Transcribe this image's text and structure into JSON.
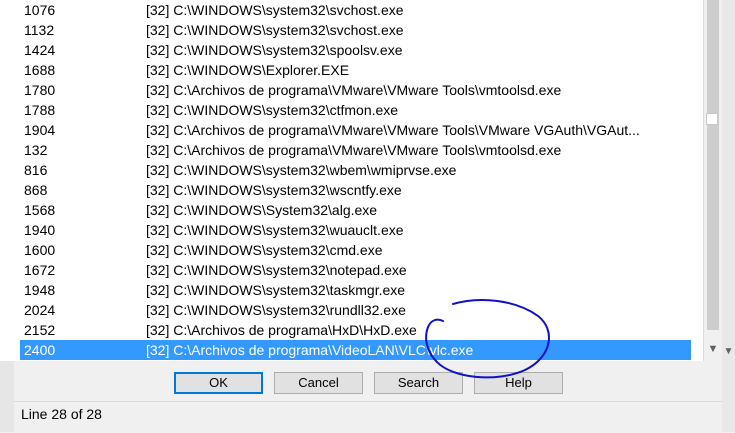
{
  "rows": [
    {
      "pid": "1076",
      "path": "[32] C:\\WINDOWS\\system32\\svchost.exe"
    },
    {
      "pid": "1132",
      "path": "[32] C:\\WINDOWS\\system32\\svchost.exe"
    },
    {
      "pid": "1424",
      "path": "[32] C:\\WINDOWS\\system32\\spoolsv.exe"
    },
    {
      "pid": "1688",
      "path": "[32] C:\\WINDOWS\\Explorer.EXE"
    },
    {
      "pid": "1780",
      "path": "[32] C:\\Archivos de programa\\VMware\\VMware Tools\\vmtoolsd.exe"
    },
    {
      "pid": "1788",
      "path": "[32] C:\\WINDOWS\\system32\\ctfmon.exe"
    },
    {
      "pid": "1904",
      "path": "[32] C:\\Archivos de programa\\VMware\\VMware Tools\\VMware VGAuth\\VGAut..."
    },
    {
      "pid": "132",
      "path": "[32] C:\\Archivos de programa\\VMware\\VMware Tools\\vmtoolsd.exe"
    },
    {
      "pid": "816",
      "path": "[32] C:\\WINDOWS\\system32\\wbem\\wmiprvse.exe"
    },
    {
      "pid": "868",
      "path": "[32] C:\\WINDOWS\\system32\\wscntfy.exe"
    },
    {
      "pid": "1568",
      "path": "[32] C:\\WINDOWS\\System32\\alg.exe"
    },
    {
      "pid": "1940",
      "path": "[32] C:\\WINDOWS\\system32\\wuauclt.exe"
    },
    {
      "pid": "1600",
      "path": "[32] C:\\WINDOWS\\system32\\cmd.exe"
    },
    {
      "pid": "1672",
      "path": "[32] C:\\WINDOWS\\system32\\notepad.exe"
    },
    {
      "pid": "1948",
      "path": "[32] C:\\WINDOWS\\system32\\taskmgr.exe"
    },
    {
      "pid": "2024",
      "path": "[32] C:\\WINDOWS\\system32\\rundll32.exe"
    },
    {
      "pid": "2152",
      "path": "[32] C:\\Archivos de programa\\HxD\\HxD.exe"
    },
    {
      "pid": "2400",
      "path": "[32] C:\\Archivos de programa\\VideoLAN\\VLC\\vlc.exe"
    }
  ],
  "selected_index": 17,
  "buttons": {
    "ok": "OK",
    "cancel": "Cancel",
    "search": "Search",
    "help": "Help"
  },
  "status": "Line 28 of 28",
  "colors": {
    "selection": "#3399ff",
    "default_button_border": "#0078d7",
    "annotation": "#1010c8"
  }
}
